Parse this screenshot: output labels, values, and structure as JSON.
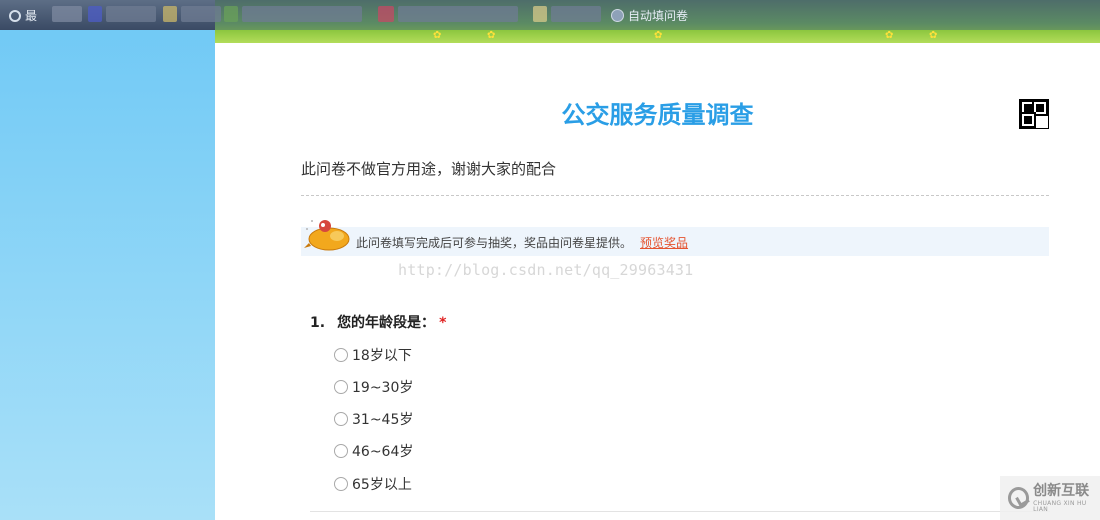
{
  "browser": {
    "bookmarks": [
      {
        "label": "最",
        "icon": "search-icon"
      },
      {
        "label": "自动填问卷",
        "icon": "globe-icon"
      }
    ]
  },
  "survey": {
    "title": "公交服务质量调查",
    "description": "此问卷不做官方用途，谢谢大家的配合",
    "notice": {
      "text": "此问卷填写完成后可参与抽奖，奖品由问卷星提供。",
      "link": "预览奖品"
    },
    "watermark": "http://blog.csdn.net/qq_29963431",
    "questions": [
      {
        "number": "1.",
        "text": "您的年龄段是：",
        "required_mark": "*",
        "options": [
          "18岁以下",
          "19~30岁",
          "31~45岁",
          "46~64岁",
          "65岁以上"
        ]
      }
    ]
  },
  "brand": {
    "name": "创新互联",
    "subtitle": "CHUANG XIN HU LIAN"
  },
  "colors": {
    "title": "#2a9ee6",
    "link": "#e5532f",
    "required": "#e02020",
    "notice_bg": "#eef5fc",
    "page_bg": "#8fd6f7"
  }
}
